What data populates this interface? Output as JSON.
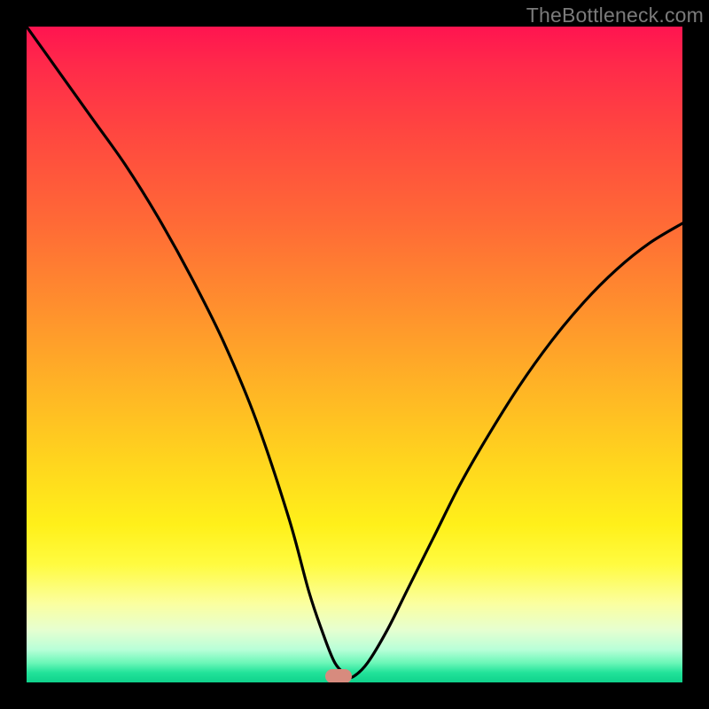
{
  "watermark": "TheBottleneck.com",
  "marker": {
    "x_pct": 47.5,
    "y_pct": 99.0,
    "color": "#d78b7e"
  },
  "chart_data": {
    "type": "line",
    "title": "",
    "xlabel": "",
    "ylabel": "",
    "xlim": [
      0,
      100
    ],
    "ylim": [
      0,
      100
    ],
    "grid": false,
    "legend": false,
    "series": [
      {
        "name": "curve",
        "x": [
          0,
          5,
          10,
          15,
          20,
          25,
          30,
          35,
          40,
          43,
          45,
          47,
          49,
          50,
          52,
          55,
          58,
          62,
          66,
          70,
          75,
          80,
          85,
          90,
          95,
          100
        ],
        "y": [
          100,
          93,
          86,
          79,
          71,
          62,
          52,
          40,
          25,
          14,
          8,
          3,
          1,
          1,
          3,
          8,
          14,
          22,
          30,
          37,
          45,
          52,
          58,
          63,
          67,
          70
        ]
      }
    ],
    "annotations": [
      {
        "type": "marker",
        "x": 47.5,
        "y": 1,
        "shape": "rounded-rect",
        "color": "#d78b7e"
      }
    ],
    "background_gradient": {
      "direction": "top-to-bottom",
      "stops": [
        {
          "pct": 0,
          "color": "#ff1450"
        },
        {
          "pct": 30,
          "color": "#ff6a36"
        },
        {
          "pct": 66,
          "color": "#ffd41e"
        },
        {
          "pct": 88,
          "color": "#fbffa0"
        },
        {
          "pct": 100,
          "color": "#0fd28b"
        }
      ]
    }
  }
}
